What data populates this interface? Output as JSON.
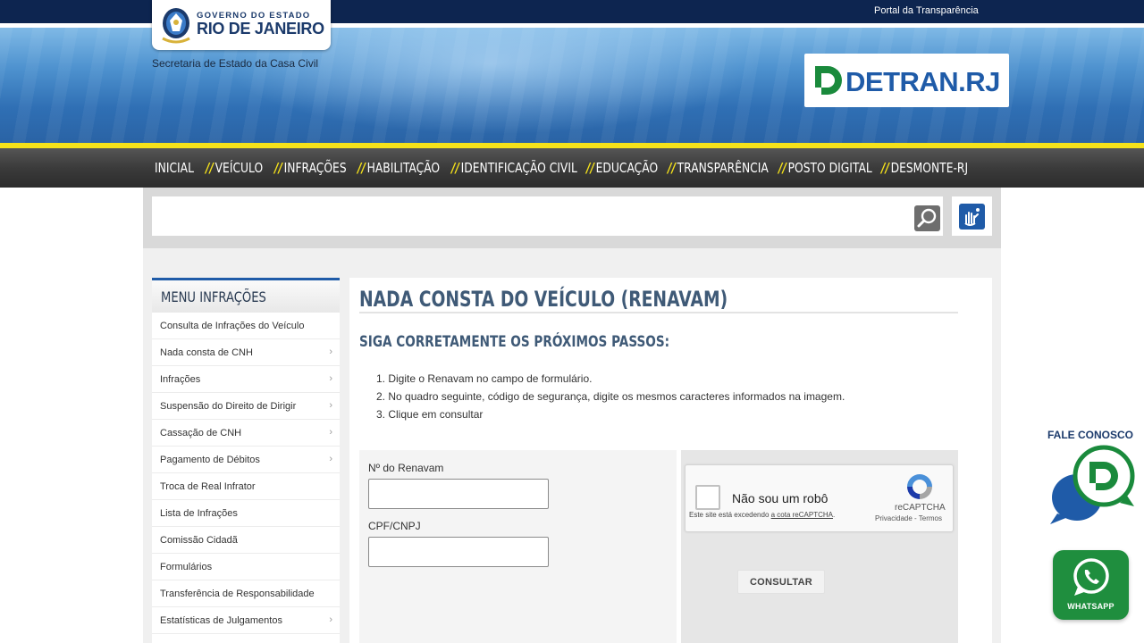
{
  "header": {
    "portal_link": "Portal da Transparência",
    "gov_line1": "GOVERNO DO ESTADO",
    "gov_line2": "RIO DE JANEIRO",
    "secretaria": "Secretaria de Estado da Casa Civil",
    "detran_logo": "DETRAN.RJ"
  },
  "nav": {
    "separator": "//",
    "items": [
      "INICIAL",
      "VEÍCULO",
      "INFRAÇÕES",
      "HABILITAÇÃO",
      "IDENTIFICAÇÃO CIVIL",
      "EDUCAÇÃO",
      "TRANSPARÊNCIA",
      "POSTO DIGITAL",
      "DESMONTE-RJ"
    ]
  },
  "search": {
    "value": ""
  },
  "sidebar": {
    "title": "MENU INFRAÇÕES",
    "chevron": "›",
    "items": [
      {
        "label": "Consulta de Infrações do Veículo",
        "has_sub": false
      },
      {
        "label": "Nada consta de CNH",
        "has_sub": true
      },
      {
        "label": "Infrações",
        "has_sub": true
      },
      {
        "label": "Suspensão do Direito de Dirigir",
        "has_sub": true
      },
      {
        "label": "Cassação de CNH",
        "has_sub": true
      },
      {
        "label": "Pagamento de Débitos",
        "has_sub": true
      },
      {
        "label": "Troca de Real Infrator",
        "has_sub": false
      },
      {
        "label": "Lista de Infrações",
        "has_sub": false
      },
      {
        "label": "Comissão Cidadã",
        "has_sub": false
      },
      {
        "label": "Formulários",
        "has_sub": false
      },
      {
        "label": "Transferência de Responsabilidade",
        "has_sub": false
      },
      {
        "label": "Estatísticas de Julgamentos",
        "has_sub": true
      }
    ]
  },
  "main": {
    "title": "NADA CONSTA DO VEÍCULO (RENAVAM)",
    "steps_title": "SIGA CORRETAMENTE OS PRÓXIMOS PASSOS:",
    "steps": [
      "1. Digite o Renavam no campo de formulário.",
      "2. No quadro seguinte, código de segurança, digite os mesmos caracteres informados na imagem.",
      "3. Clique em consultar"
    ],
    "form": {
      "renavam_label": "Nº do Renavam",
      "renavam_value": "",
      "cpf_label": "CPF/CNPJ",
      "cpf_value": "",
      "submit_label": "CONSULTAR"
    },
    "captcha": {
      "label": "Não sou um robô",
      "brand": "reCAPTCHA",
      "links": "Privacidade - Termos",
      "warning_prefix": "Este site está excedendo ",
      "warning_link": "a cota reCAPTCHA",
      "warning_suffix": "."
    }
  },
  "widgets": {
    "fale_conosco": "FALE CONOSCO",
    "whatsapp": "WHATSAPP"
  },
  "colors": {
    "brand_blue": "#1f5ba8",
    "nav_accent": "#f5e21a",
    "whatsapp_green": "#1f8e3e",
    "title_slate": "#3f5a77"
  },
  "icons": [
    "state-seal-icon",
    "detran-logo-icon",
    "search-icon",
    "accessibility-hands-icon",
    "recaptcha-icon",
    "chat-bubble-icon",
    "whatsapp-icon"
  ]
}
